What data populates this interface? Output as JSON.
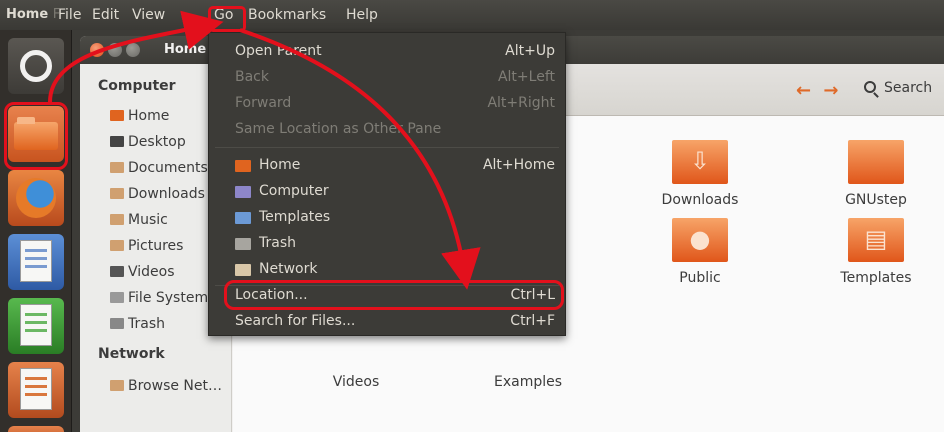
{
  "topbar": {
    "app_title": "Home",
    "app_title_fade": "F",
    "menus": [
      "File",
      "Edit",
      "View",
      "Go",
      "Bookmarks",
      "Help"
    ]
  },
  "window": {
    "title": "Home",
    "search_label": "Search"
  },
  "sidebar": {
    "computer_header": "Computer",
    "computer_items": [
      {
        "label": "Home",
        "icon": "home-folder-icon",
        "color": "#e0641f"
      },
      {
        "label": "Desktop",
        "icon": "desktop-icon",
        "color": "#444"
      },
      {
        "label": "Documents",
        "icon": "documents-folder-icon",
        "color": "#d0a070"
      },
      {
        "label": "Downloads",
        "icon": "downloads-folder-icon",
        "color": "#d0a070"
      },
      {
        "label": "Music",
        "icon": "music-folder-icon",
        "color": "#d0a070"
      },
      {
        "label": "Pictures",
        "icon": "pictures-folder-icon",
        "color": "#d0a070"
      },
      {
        "label": "Videos",
        "icon": "videos-folder-icon",
        "color": "#555"
      },
      {
        "label": "File System",
        "icon": "harddisk-icon",
        "color": "#999"
      },
      {
        "label": "Trash",
        "icon": "trash-icon",
        "color": "#888"
      }
    ],
    "network_header": "Network",
    "network_items": [
      {
        "label": "Browse Net…",
        "icon": "network-icon",
        "color": "#d0a070"
      }
    ]
  },
  "content": {
    "folders": [
      {
        "label": "Downloads",
        "icon": "downloads-folder-icon"
      },
      {
        "label": "GNUstep",
        "icon": "folder-icon"
      },
      {
        "label": "Public",
        "icon": "public-folder-icon"
      },
      {
        "label": "Templates",
        "icon": "templates-folder-icon"
      },
      {
        "label": "Videos",
        "icon": "videos-folder-icon"
      },
      {
        "label": "Examples",
        "icon": "examples-folder-icon"
      }
    ]
  },
  "go_menu": {
    "items": [
      {
        "label": "Open Parent",
        "accel": "Alt+Up",
        "enabled": true
      },
      {
        "label": "Back",
        "accel": "Alt+Left",
        "enabled": false
      },
      {
        "label": "Forward",
        "accel": "Alt+Right",
        "enabled": false
      },
      {
        "label": "Same Location as Other Pane",
        "accel": "",
        "enabled": false
      },
      {
        "label": "Home",
        "accel": "Alt+Home",
        "enabled": true,
        "icon": "home-folder-icon"
      },
      {
        "label": "Computer",
        "accel": "",
        "enabled": true,
        "icon": "computer-icon"
      },
      {
        "label": "Templates",
        "accel": "",
        "enabled": true,
        "icon": "templates-icon"
      },
      {
        "label": "Trash",
        "accel": "",
        "enabled": true,
        "icon": "trash-icon"
      },
      {
        "label": "Network",
        "accel": "",
        "enabled": true,
        "icon": "network-icon"
      },
      {
        "label": "Location...",
        "accel": "Ctrl+L",
        "enabled": true
      },
      {
        "label": "Search for Files...",
        "accel": "Ctrl+F",
        "enabled": true
      }
    ]
  },
  "colors": {
    "annotation": "#e3101c",
    "accent": "#df6a29"
  }
}
